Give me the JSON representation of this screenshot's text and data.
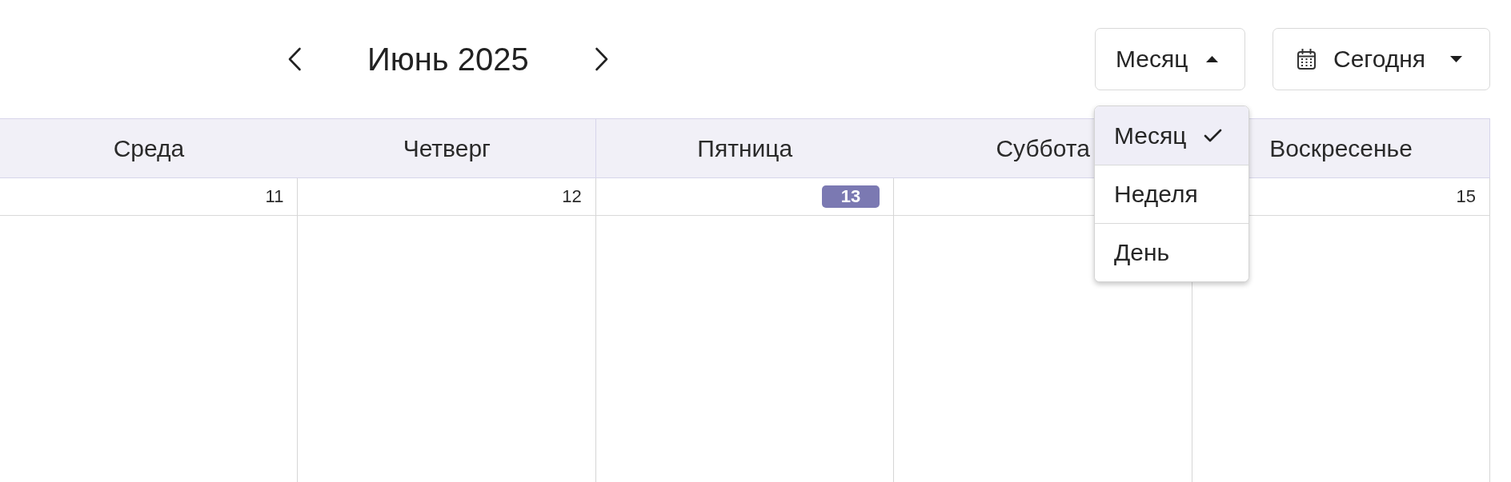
{
  "header": {
    "title": "Июнь 2025",
    "view_button": {
      "label": "Месяц",
      "expanded": true
    },
    "today_button": {
      "label": "Сегодня",
      "expanded": false
    }
  },
  "view_menu": {
    "items": [
      {
        "label": "Месяц",
        "selected": true
      },
      {
        "label": "Неделя",
        "selected": false
      },
      {
        "label": "День",
        "selected": false
      }
    ]
  },
  "calendar": {
    "days": [
      {
        "weekday": "Среда",
        "date": "11",
        "today": false
      },
      {
        "weekday": "Четверг",
        "date": "12",
        "today": false
      },
      {
        "weekday": "Пятница",
        "date": "13",
        "today": true
      },
      {
        "weekday": "Суббота"
      },
      {
        "weekday": "Воскресенье",
        "date": "15",
        "today": false
      }
    ]
  }
}
